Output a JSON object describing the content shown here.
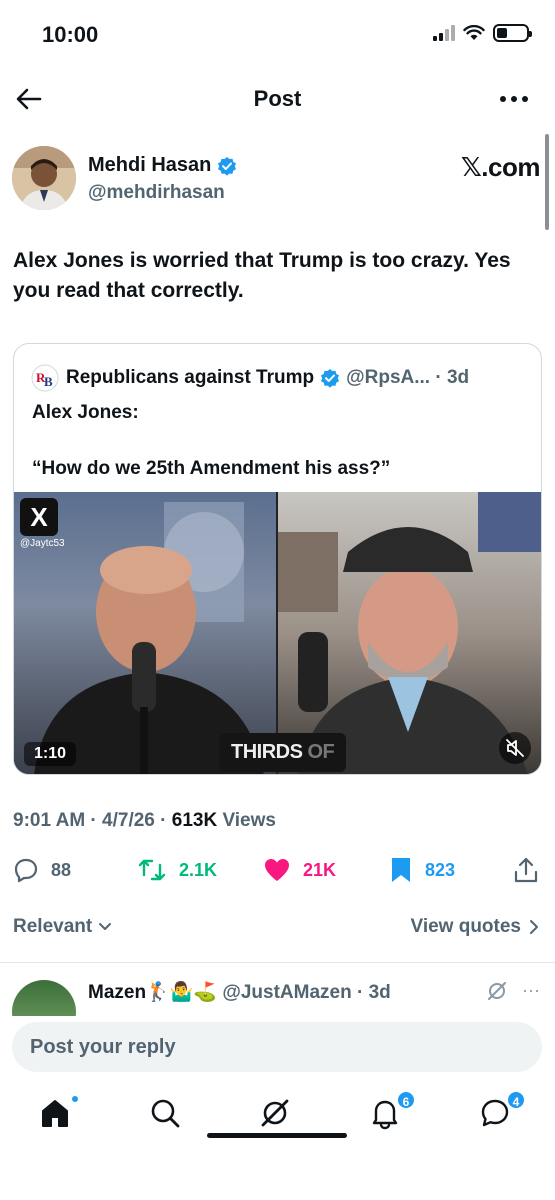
{
  "status_bar": {
    "time": "10:00",
    "battery_level": 0.35
  },
  "header": {
    "title": "Post"
  },
  "author": {
    "name": "Mehdi Hasan",
    "handle": "@mehdirhasan",
    "source": "𝕏.com"
  },
  "post": {
    "text": "Alex Jones is worried that Trump is too crazy. Yes you read that correctly."
  },
  "quote": {
    "name": "Republicans against Trump",
    "handle_time": "@RpsA... · 3d",
    "text": "Alex Jones:\n\n“How do we 25th Amendment his ass?”",
    "media": {
      "badge": "X",
      "watermark": "@Jaytc53",
      "duration": "1:10",
      "caption_main": "THIRDS ",
      "caption_dim": "OF"
    }
  },
  "meta": {
    "time_date": "9:01 AM · 4/7/26 · ",
    "views_count": "613K",
    "views_label": " Views"
  },
  "actions": {
    "replies": "88",
    "reposts": "2.1K",
    "likes": "21K",
    "bookmarks": "823"
  },
  "sort": {
    "relevant": "Relevant",
    "view_quotes": "View quotes"
  },
  "reply": {
    "name": "Mazen🏌️🤷‍♂️⛳",
    "handle_time": "@JustAMazen · 3d",
    "more": "···"
  },
  "reply_bar": {
    "placeholder": "Post your reply"
  },
  "tabs": {
    "notifications_count": "6",
    "messages_count": "4"
  },
  "colors": {
    "accent": "#1d9bf0",
    "repost": "#00ba7c",
    "like": "#f91880",
    "muted": "#536471"
  }
}
